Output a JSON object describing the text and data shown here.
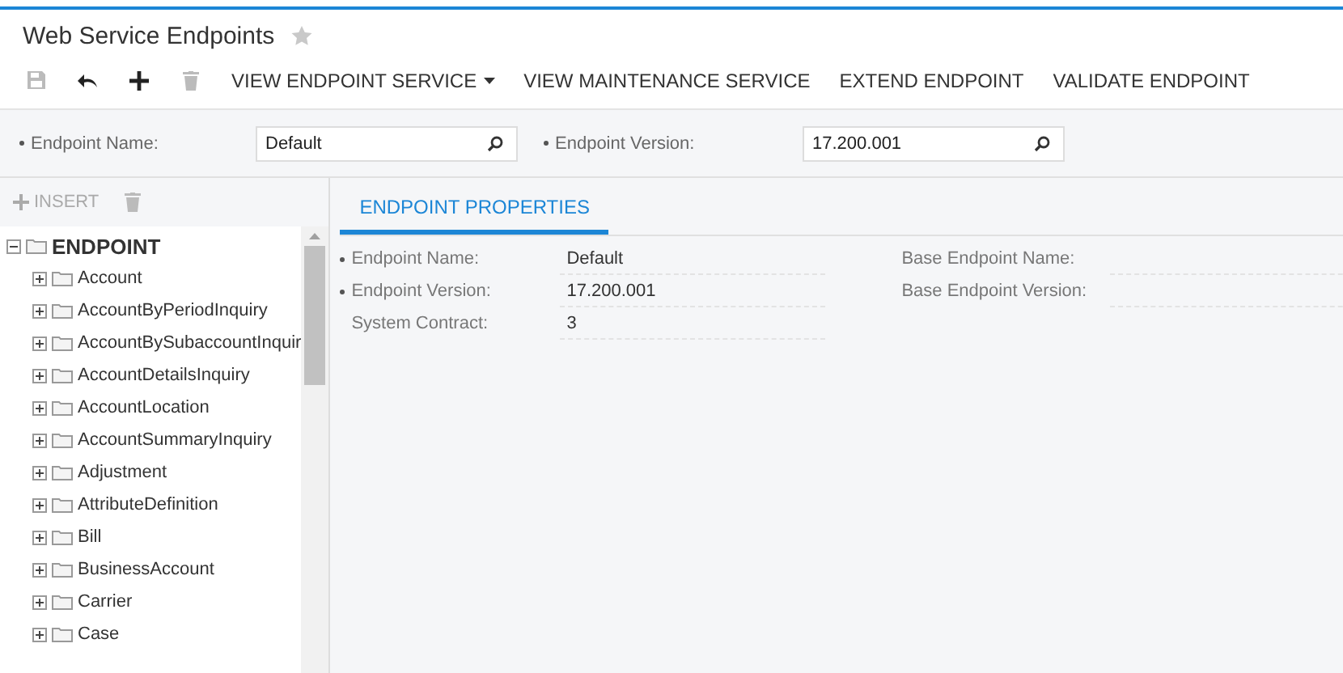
{
  "title": "Web Service Endpoints",
  "favorite": false,
  "toolbar": [
    {
      "kind": "save",
      "disabled": true
    },
    {
      "kind": "undo",
      "disabled": false
    },
    {
      "kind": "add",
      "disabled": false
    },
    {
      "kind": "delete",
      "disabled": true
    },
    {
      "kind": "text",
      "label": "VIEW ENDPOINT SERVICE",
      "dropdown": true
    },
    {
      "kind": "text",
      "label": "VIEW MAINTENANCE SERVICE",
      "dropdown": false
    },
    {
      "kind": "text",
      "label": "EXTEND ENDPOINT",
      "dropdown": false
    },
    {
      "kind": "text",
      "label": "VALIDATE ENDPOINT",
      "dropdown": false
    }
  ],
  "header_fields": [
    {
      "label": "Endpoint Name:",
      "required": true,
      "value": "Default"
    },
    {
      "label": "Endpoint Version:",
      "required": true,
      "value": "17.200.001"
    }
  ],
  "tree_toolbar": {
    "insert": "INSERT",
    "disabled": true
  },
  "tree": [
    {
      "label": "ENDPOINT",
      "expanded": true,
      "children": [
        {
          "label": "Account",
          "expanded": false
        },
        {
          "label": "AccountByPeriodInquiry",
          "expanded": false
        },
        {
          "label": "AccountBySubaccountInquir",
          "expanded": false
        },
        {
          "label": "AccountDetailsInquiry",
          "expanded": false
        },
        {
          "label": "AccountLocation",
          "expanded": false
        },
        {
          "label": "AccountSummaryInquiry",
          "expanded": false
        },
        {
          "label": "Adjustment",
          "expanded": false
        },
        {
          "label": "AttributeDefinition",
          "expanded": false
        },
        {
          "label": "Bill",
          "expanded": false
        },
        {
          "label": "BusinessAccount",
          "expanded": false
        },
        {
          "label": "Carrier",
          "expanded": false
        },
        {
          "label": "Case",
          "expanded": false
        }
      ]
    }
  ],
  "tabs": [
    {
      "label": "ENDPOINT PROPERTIES",
      "selected": true
    }
  ],
  "properties_left": [
    {
      "label": "Endpoint Name:",
      "required": true,
      "value": "Default"
    },
    {
      "label": "Endpoint Version:",
      "required": true,
      "value": "17.200.001"
    },
    {
      "label": "System Contract:",
      "required": false,
      "value": "3"
    }
  ],
  "properties_right": [
    {
      "label": "Base Endpoint Name:",
      "required": false
    },
    {
      "label": "Base Endpoint Version:",
      "required": false
    }
  ]
}
